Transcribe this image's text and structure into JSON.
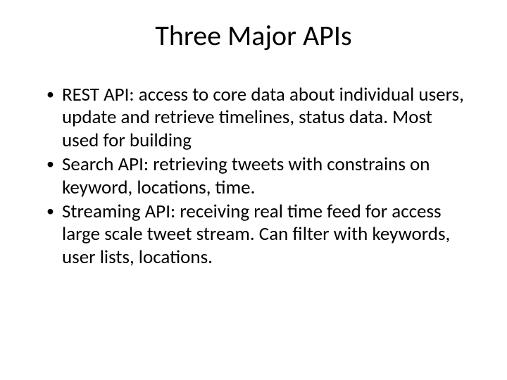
{
  "title": "Three Major APIs",
  "bullets": [
    "REST API: access to core data about individual users, update and retrieve timelines, status data. Most used for building",
    "Search API: retrieving tweets with constrains on keyword, locations, time.",
    "Streaming API: receiving real time feed for access large scale tweet stream. Can filter with keywords, user lists, locations."
  ]
}
